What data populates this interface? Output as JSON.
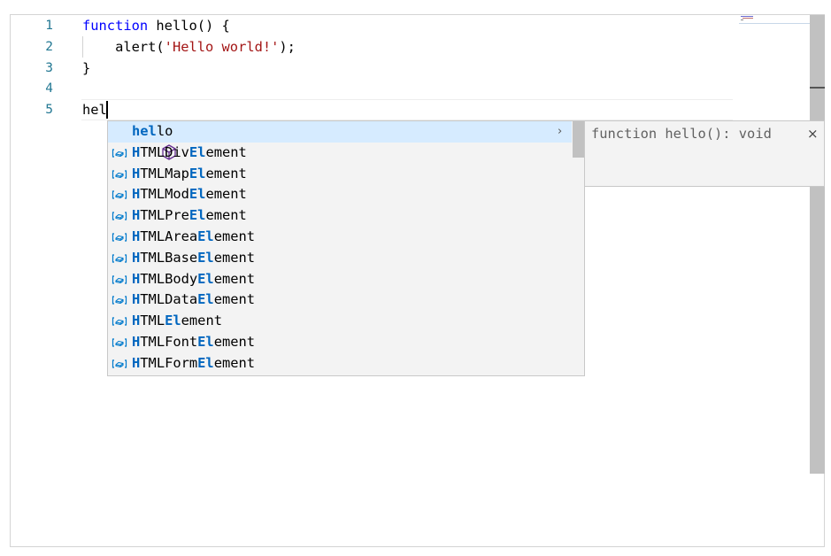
{
  "editor": {
    "line_numbers": [
      "1",
      "2",
      "3",
      "4",
      "5"
    ],
    "lines": {
      "l1_kw": "function",
      "l1_rest": " hello() {",
      "l2_pre": "    alert(",
      "l2_str": "'Hello world!'",
      "l2_post": ");",
      "l3": "}",
      "l4": "",
      "l5": "hel"
    }
  },
  "suggest": {
    "items": [
      {
        "hl1": "hel",
        "mid": "lo",
        "hl2": "",
        "rest": "",
        "kind": "function-icon",
        "selected": true
      },
      {
        "hl1": "H",
        "mid": "TMLDiv",
        "hl2": "El",
        "rest": "ement",
        "kind": "variable-icon"
      },
      {
        "hl1": "H",
        "mid": "TMLMap",
        "hl2": "El",
        "rest": "ement",
        "kind": "variable-icon"
      },
      {
        "hl1": "H",
        "mid": "TMLMod",
        "hl2": "El",
        "rest": "ement",
        "kind": "variable-icon"
      },
      {
        "hl1": "H",
        "mid": "TMLPre",
        "hl2": "El",
        "rest": "ement",
        "kind": "variable-icon"
      },
      {
        "hl1": "H",
        "mid": "TMLArea",
        "hl2": "El",
        "rest": "ement",
        "kind": "variable-icon"
      },
      {
        "hl1": "H",
        "mid": "TMLBase",
        "hl2": "El",
        "rest": "ement",
        "kind": "variable-icon"
      },
      {
        "hl1": "H",
        "mid": "TMLBody",
        "hl2": "El",
        "rest": "ement",
        "kind": "variable-icon"
      },
      {
        "hl1": "H",
        "mid": "TMLData",
        "hl2": "El",
        "rest": "ement",
        "kind": "variable-icon"
      },
      {
        "hl1": "H",
        "mid": "TML",
        "hl2": "El",
        "rest": "ement",
        "kind": "variable-icon"
      },
      {
        "hl1": "H",
        "mid": "TMLFont",
        "hl2": "El",
        "rest": "ement",
        "kind": "variable-icon"
      },
      {
        "hl1": "H",
        "mid": "TMLForm",
        "hl2": "El",
        "rest": "ement",
        "kind": "variable-icon"
      }
    ],
    "chevron": "›"
  },
  "details": {
    "signature": "function hello(): void",
    "close": "×"
  },
  "colors": {
    "keyword": "#0000ff",
    "string": "#a31515",
    "match_highlight": "#0066bf",
    "selected_row": "#d6ebff",
    "line_number": "#237893"
  }
}
